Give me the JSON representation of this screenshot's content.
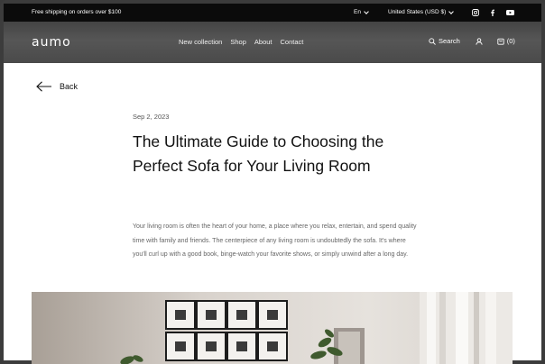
{
  "announcement": {
    "text": "Free shipping on orders over $100",
    "language": "En",
    "region": "United States (USD $)",
    "social": [
      "instagram-icon",
      "facebook-icon",
      "youtube-icon"
    ]
  },
  "header": {
    "logo": "aumo",
    "nav": [
      "New collection",
      "Shop",
      "About",
      "Contact"
    ],
    "search_label": "Search",
    "cart_count": "(0)"
  },
  "article": {
    "back_label": "Back",
    "date": "Sep 2, 2023",
    "title": "The Ultimate Guide to Choosing the Perfect Sofa for Your Living Room",
    "intro": "Your living room is often the heart of your home, a place where you relax, entertain, and spend quality time with family and friends. The centerpiece of any living room is undoubtedly the sofa. It's where you'll curl up with a good book, binge-watch your favorite shows, or simply unwind after a long day."
  },
  "colors": {
    "announcement_bg": "#0b0b0b",
    "header_bg": "#4e4e4e",
    "page_bg": "#ffffff",
    "body_text": "#666666"
  }
}
